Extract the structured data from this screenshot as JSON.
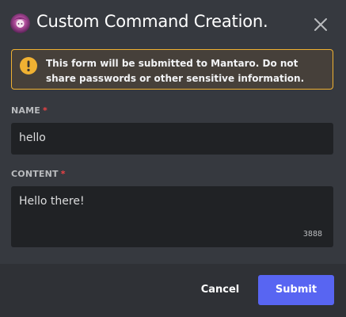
{
  "modal": {
    "title": "Custom Command Creation.",
    "app_icon": "app-avatar",
    "close_icon": "close-icon"
  },
  "notice": {
    "icon": "warning-icon",
    "text_before": "This form will be submitted to ",
    "app_name": "Mantaro",
    "text_after": ". Do not share passwords or other sensitive information."
  },
  "fields": {
    "name": {
      "label": "NAME",
      "required_mark": "*",
      "value": "hello"
    },
    "content": {
      "label": "CONTENT",
      "required_mark": "*",
      "value": "Hello there!",
      "remaining_chars": "3888"
    }
  },
  "footer": {
    "cancel_label": "Cancel",
    "submit_label": "Submit"
  },
  "colors": {
    "accent": "#5865f2",
    "warning": "#f0b132",
    "required": "#ed4245",
    "background": "#36393f",
    "footer_bg": "#2f3136",
    "input_bg": "#202225"
  }
}
